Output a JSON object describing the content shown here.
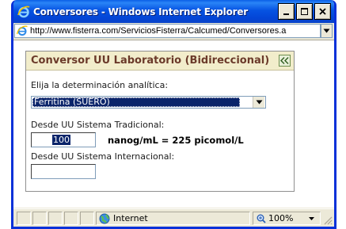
{
  "window": {
    "title": "Conversores - Windows Internet Explorer"
  },
  "address": {
    "url": "http://www.fisterra.com/ServiciosFisterra/Calcumed/Conversores.a"
  },
  "panel": {
    "title": "Conversor UU Laboratorio (Bidireccional)",
    "determination_label": "Elija la determinación analítica:",
    "determination_value": "Ferritina (SUERO)",
    "traditional_label": "Desde UU Sistema Tradicional:",
    "traditional_value": "100",
    "result_text": "nanog/mL = 225 picomol/L",
    "international_label": "Desde UU Sistema Internacional:",
    "international_value": ""
  },
  "status": {
    "zone": "Internet",
    "zoom": "100%"
  },
  "icons": {
    "app": "ie-icon",
    "minimize": "minimize-icon",
    "maximize": "maximize-icon",
    "close": "close-icon",
    "collapse": "double-chevron-left-icon",
    "zone": "globe-icon",
    "zoom": "magnifier-icon"
  },
  "colors": {
    "titlebar": "#0653e2",
    "panel_header": "#f2edcb",
    "panel_title": "#6b3a2a",
    "selection": "#0a246a"
  }
}
